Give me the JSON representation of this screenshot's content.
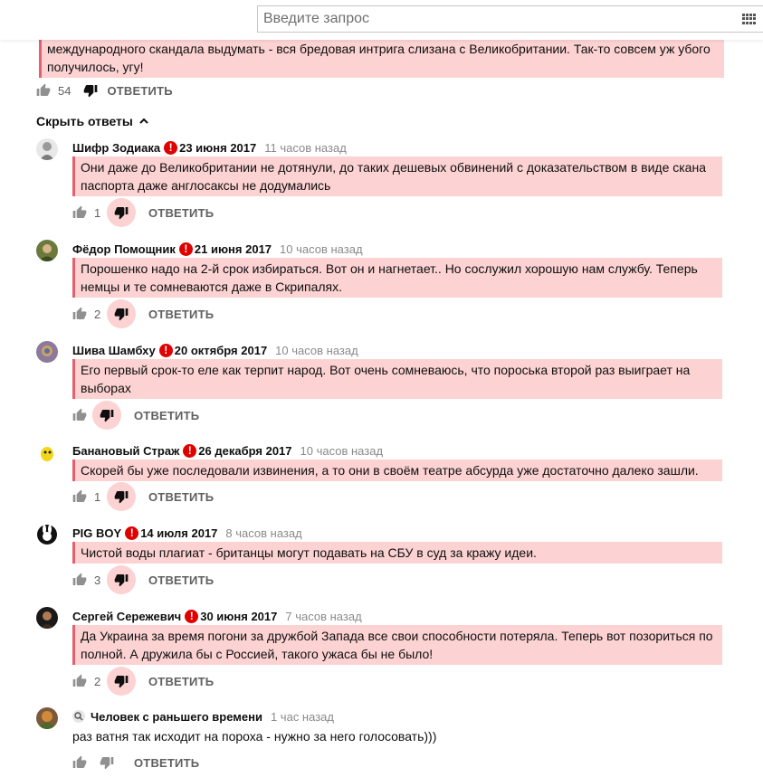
{
  "search": {
    "placeholder": "Введите запрос"
  },
  "top_comment": {
    "text_line1": "международного скандала выдумать - вся бредовая интрига слизана с Великобритании. Так-то совсем уж убого",
    "text_line2": "получилось, угу!",
    "likes": "54",
    "reply_label": "ОТВЕТИТЬ"
  },
  "hide_replies_label": "Скрыть ответы",
  "colors": {
    "highlight": "#fcd2d2",
    "highlight_border": "#e4606d",
    "badge": "#e00000"
  },
  "replies": [
    {
      "author": "Шифр Зодиака",
      "date": "23 июня 2017",
      "ago": "11 часов назад",
      "text": "Они даже до Великобритании не дотянули, до таких дешевых обвинений с доказательством в виде скана паспорта даже англосаксы не додумались",
      "likes": "1",
      "reply_label": "ОТВЕТИТЬ",
      "avatar_icon": "grey-figure-avatar"
    },
    {
      "author": "Фёдор Помощник",
      "date": "21 июня 2017",
      "ago": "10 часов назад",
      "text": "Порошенко надо на 2-й срок избираться. Вот он и нагнетает.. Но сослужил хорошую нам службу. Теперь немцы и те сомневаются даже в Скрипалях.",
      "likes": "2",
      "reply_label": "ОТВЕТИТЬ",
      "avatar_icon": "man-portrait-avatar"
    },
    {
      "author": "Шива Шамбху",
      "date": "20 октября 2017",
      "ago": "10 часов назад",
      "text": "Его первый срок-то еле как терпит народ. Вот очень сомневаюсь, что пороська второй раз выиграет на выборах",
      "likes": "",
      "reply_label": "ОТВЕТИТЬ",
      "avatar_icon": "deity-avatar"
    },
    {
      "author": "Банановый Страж",
      "date": "26 декабря 2017",
      "ago": "10 часов назад",
      "text": "Скорей бы уже последовали извинения, а то они в своём театре абсурда уже достаточно далеко зашли.",
      "likes": "1",
      "reply_label": "ОТВЕТИТЬ",
      "avatar_icon": "yellow-creature-avatar"
    },
    {
      "author": "PIG BOY",
      "date": "14 июля 2017",
      "ago": "8 часов назад",
      "text": "Чистой воды плагиат - британцы могут подавать на СБУ в суд за кражу идеи.",
      "likes": "3",
      "reply_label": "ОТВЕТИТЬ",
      "avatar_icon": "bunny-logo-avatar"
    },
    {
      "author": "Сергей Сережевич",
      "date": "30 июня 2017",
      "ago": "7 часов назад",
      "text": "Да Украина за время погони за дружбой Запада все свои способности потеряла. Теперь вот позориться по полной. А дружила бы с Россией, такого ужаса бы не было!",
      "likes": "2",
      "reply_label": "ОТВЕТИТЬ",
      "avatar_icon": "dark-portrait-avatar"
    },
    {
      "author": "Человек с раньшего времени",
      "date": "",
      "ago": "1 час назад",
      "text": "раз ватня так исходит на пороха - нужно за него голосовать)))",
      "likes": "",
      "reply_label": "ОТВЕТИТЬ",
      "avatar_icon": "colorful-avatar"
    }
  ]
}
